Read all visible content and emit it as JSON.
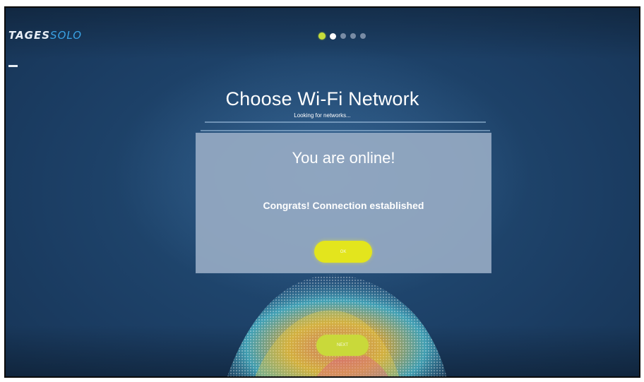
{
  "header": {
    "logo_primary": "TAGES",
    "logo_secondary": "SOLO",
    "progress": {
      "total_steps": 5,
      "current_step": 2
    }
  },
  "page": {
    "title": "Choose Wi-Fi Network",
    "subtitle": "Looking for networks..."
  },
  "dialog": {
    "title": "You are online!",
    "message": "Congrats! Connection established",
    "ok_label": "OK"
  },
  "footer": {
    "next_label": "NEXT"
  },
  "colors": {
    "accent": "#e3e51d",
    "done_step": "#c6dc3a",
    "background": "#1b3d63",
    "dialog_bg": "#96aac3"
  },
  "icons": [
    "back-icon"
  ]
}
